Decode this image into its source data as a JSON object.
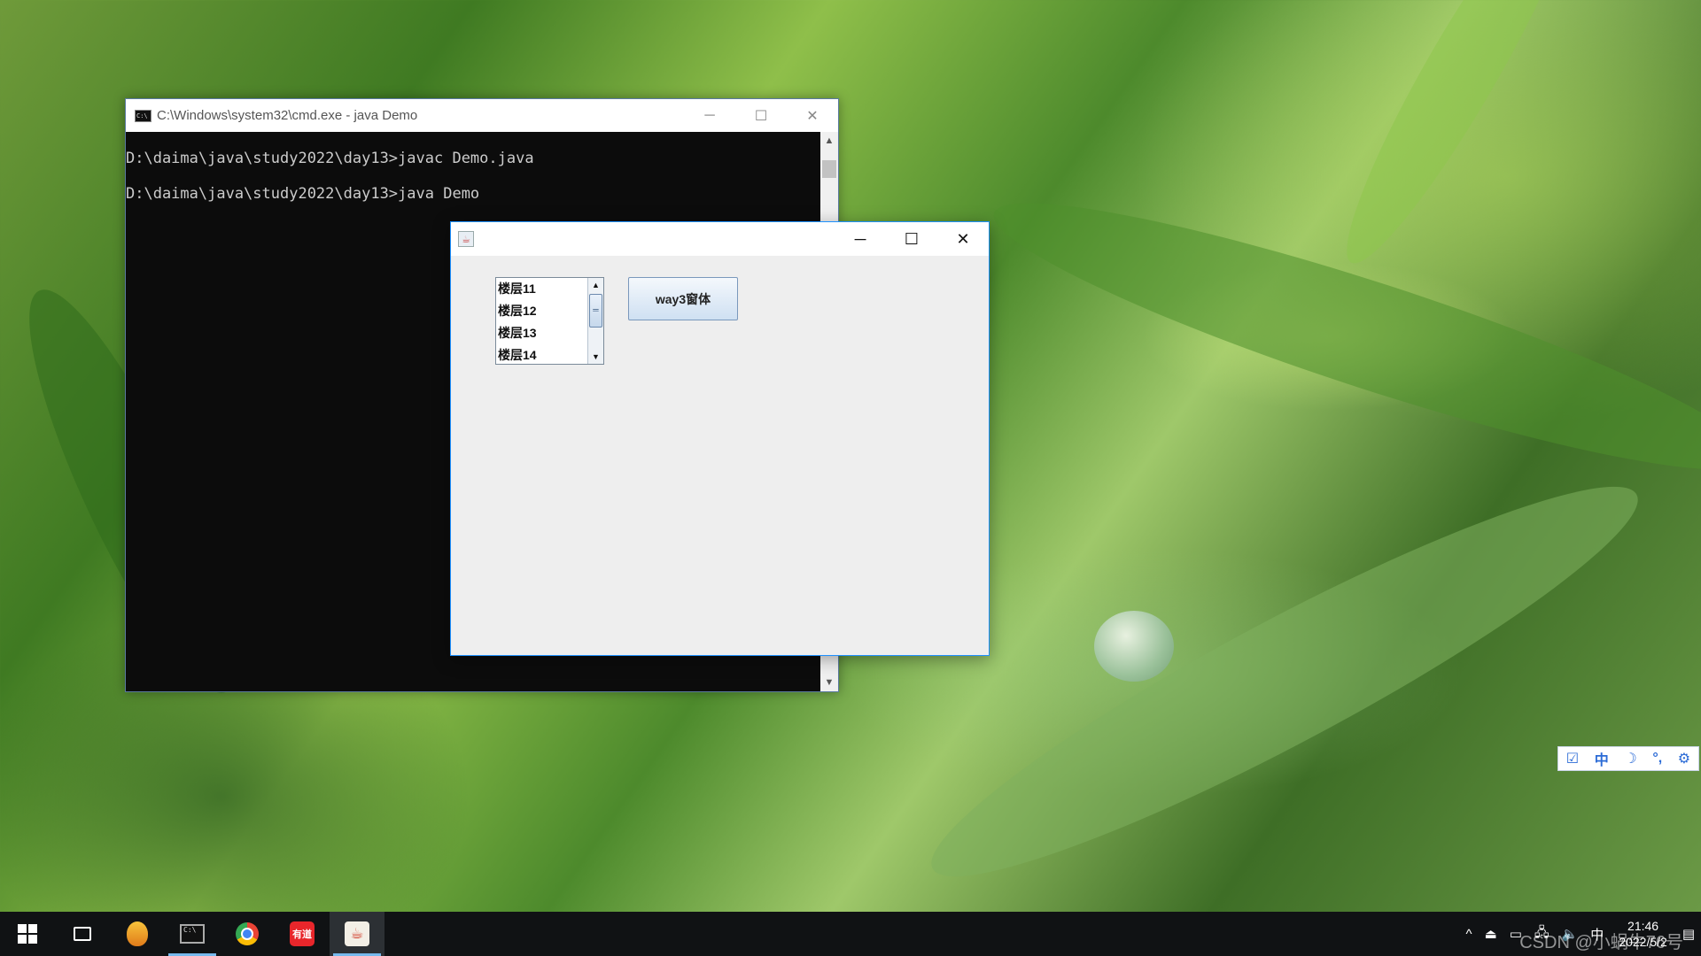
{
  "cmd_window": {
    "title": "C:\\Windows\\system32\\cmd.exe - java  Demo",
    "icon_label": "C:\\",
    "minimize": "─",
    "maximize": "☐",
    "close": "✕",
    "lines": [
      "D:\\daima\\java\\study2022\\day13>javac Demo.java",
      "D:\\daima\\java\\study2022\\day13>java Demo"
    ],
    "scroll_up": "▲",
    "scroll_down": "▼"
  },
  "java_window": {
    "icon": "☕",
    "minimize": "─",
    "maximize": "☐",
    "close": "✕",
    "list_items": [
      "楼层11",
      "楼层12",
      "楼层13",
      "楼层14"
    ],
    "list_scroll_up": "▲",
    "list_scroll_down": "▼",
    "list_thumb_grip": "═",
    "button_label": "way3窗体"
  },
  "ime_toolbar": {
    "items": [
      "☑",
      "中",
      "☽",
      "°,",
      "⚙"
    ]
  },
  "taskbar": {
    "cmd_icon_label": "C:\\",
    "youdao_label": "有道",
    "java_icon": "☕",
    "tray": {
      "chevron": "^",
      "ime_label": "中",
      "time": "21:46",
      "date": "2022/5/2",
      "notification_icon": "▤"
    },
    "watermark": "CSDN @小蜗牛76号"
  },
  "colors": {
    "cmd_bg": "#0c0c0c",
    "swing_bg": "#eeeeee",
    "accent": "#1e90ff",
    "taskbar_bg": "#101214"
  }
}
